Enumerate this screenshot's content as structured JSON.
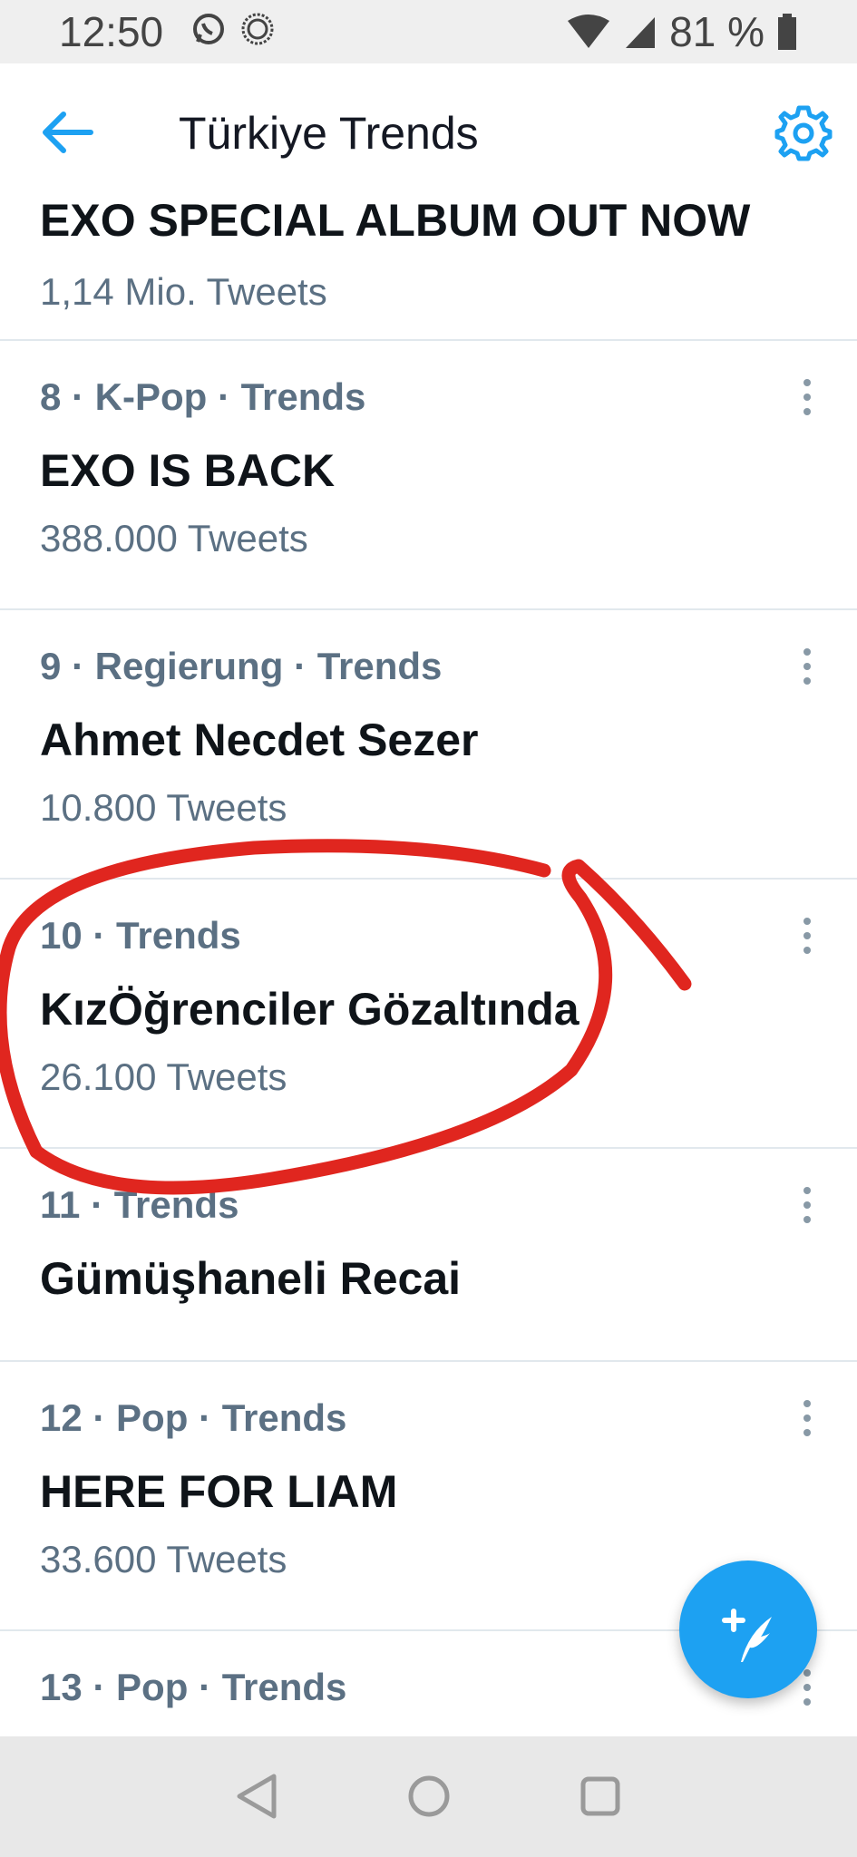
{
  "status": {
    "time": "12:50",
    "battery": "81 %",
    "left_icons": [
      "whatsapp-icon",
      "clock-icon"
    ],
    "right_icons": [
      "wifi-icon",
      "signal-icon",
      "battery-icon"
    ]
  },
  "header": {
    "title": "Türkiye Trends"
  },
  "trends": [
    {
      "meta": "",
      "name": "EXO SPECIAL ALBUM OUT NOW",
      "count": "1,14 Mio. Tweets"
    },
    {
      "meta": "8 · K-Pop · Trends",
      "name": "EXO IS BACK",
      "count": "388.000 Tweets"
    },
    {
      "meta": "9 · Regierung · Trends",
      "name": "Ahmet Necdet Sezer",
      "count": "10.800 Tweets"
    },
    {
      "meta": "10 · Trends",
      "name": "KızÖğrenciler Gözaltında",
      "count": "26.100 Tweets"
    },
    {
      "meta": "11 · Trends",
      "name": "Gümüşhaneli Recai",
      "count": ""
    },
    {
      "meta": "12 · Pop · Trends",
      "name": "HERE FOR LIAM",
      "count": "33.600 Tweets"
    },
    {
      "meta": "13 · Pop · Trends",
      "name": "",
      "count": ""
    }
  ],
  "colors": {
    "accent": "#1da1f2",
    "annotation": "#e0261f"
  }
}
